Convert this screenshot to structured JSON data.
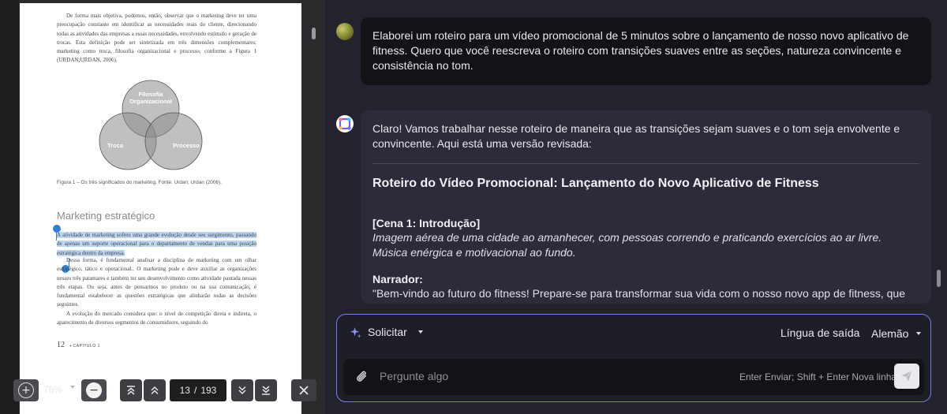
{
  "pdf": {
    "intro_paragraph": "De forma mais objetiva, podemos, então, observar que o marketing deve ter uma preocupação constante em identificar as necessidades reais do cliente, direcionando todas as atividades das empresas a essas necessidades, envolvendo estímulo e geração de trocas. Esta definição pode ser sintetizada em três dimensões complementares: marketing como troca, filosofia organizacional e processo, conforme a Figura 1 (URDAN;URDAN, 2006).",
    "venn": {
      "top_label_line1": "Filosofia",
      "top_label_line2": "Organizacional",
      "left_label": "Troca",
      "right_label": "Processo"
    },
    "figure_caption": "Figura 1 – Os três significados do marketing. Fonte: Urdan; Urdan (2006).",
    "section_heading": "Marketing estratégico",
    "highlighted_paragraph": "A atividade de marketing sofreu uma grande evolução desde seu surgimento, passando de apenas um suporte operacional para o departamento de vendas para uma posição estratégica dentro da empresa.",
    "paragraph_2": "Dessa forma, é fundamental analisar a disciplina de marketing com um olhar estratégico, tático e operacional.. O marketing pode e deve auxiliar as organizações nesses três patamares e também ter seu desenvolvimento como atividade pautada nessas três etapas. Ou seja, antes de pensarmos no produto ou na sua comunicação, é fundamental estabelecer as questões estratégicas que alinharão todas as decisões seguintes.",
    "paragraph_3": "A evolução do mercado considera que: o nível de competição direta e indireta, o aparecimento de diversos segmentos de consumidores, seguindo do",
    "page_number": "12",
    "chapter_label": "CAPÍTULO 1"
  },
  "pdf_toolbar": {
    "zoom_level": "76%",
    "current_page": "13",
    "page_separator": "/",
    "total_pages": "193"
  },
  "chat": {
    "user_message": "Elaborei um roteiro para um vídeo promocional de 5 minutos sobre o lançamento de nosso novo aplicativo de fitness. Quero que você reescreva o roteiro com transições suaves entre as seções, natureza convincente e consistência no tom.",
    "assistant": {
      "intro": "Claro! Vamos trabalhar nesse roteiro de maneira que as transições sejam suaves e o tom seja envolvente e convincente. Aqui está uma versão revisada:",
      "script_title": "Roteiro do Vídeo Promocional: Lançamento do Novo Aplicativo de Fitness",
      "scene_label": "[Cena 1: Introdução]",
      "scene_description": "Imagem aérea de uma cidade ao amanhecer, com pessoas correndo e praticando exercícios ao ar livre. Música enérgica e motivacional ao fundo.",
      "narrator_label": "Narrador:",
      "narrator_line": "\"Bem-vindo ao futuro do fitness! Prepare-se para transformar sua vida com o nosso novo app de fitness, que"
    }
  },
  "composer": {
    "prompt_label": "Solicitar",
    "output_language_label": "Língua de saída",
    "output_language_value": "Alemão",
    "input_placeholder": "Pergunte algo",
    "send_hint": "Enter Enviar; Shift + Enter Nova linha"
  },
  "colors": {
    "accent_border": "#7b7bf0",
    "highlight": "#bcd6f3",
    "selection_handle": "#2f80d6"
  },
  "icons": [
    "plus-circle-icon",
    "minus-circle-icon",
    "chevrons-up-bar-icon",
    "chevrons-up-icon",
    "chevrons-down-icon",
    "chevrons-down-bar-icon",
    "close-icon",
    "sparkle-icon",
    "caret-down-icon",
    "paperclip-icon",
    "send-icon",
    "assistant-logo-icon",
    "user-avatar"
  ]
}
